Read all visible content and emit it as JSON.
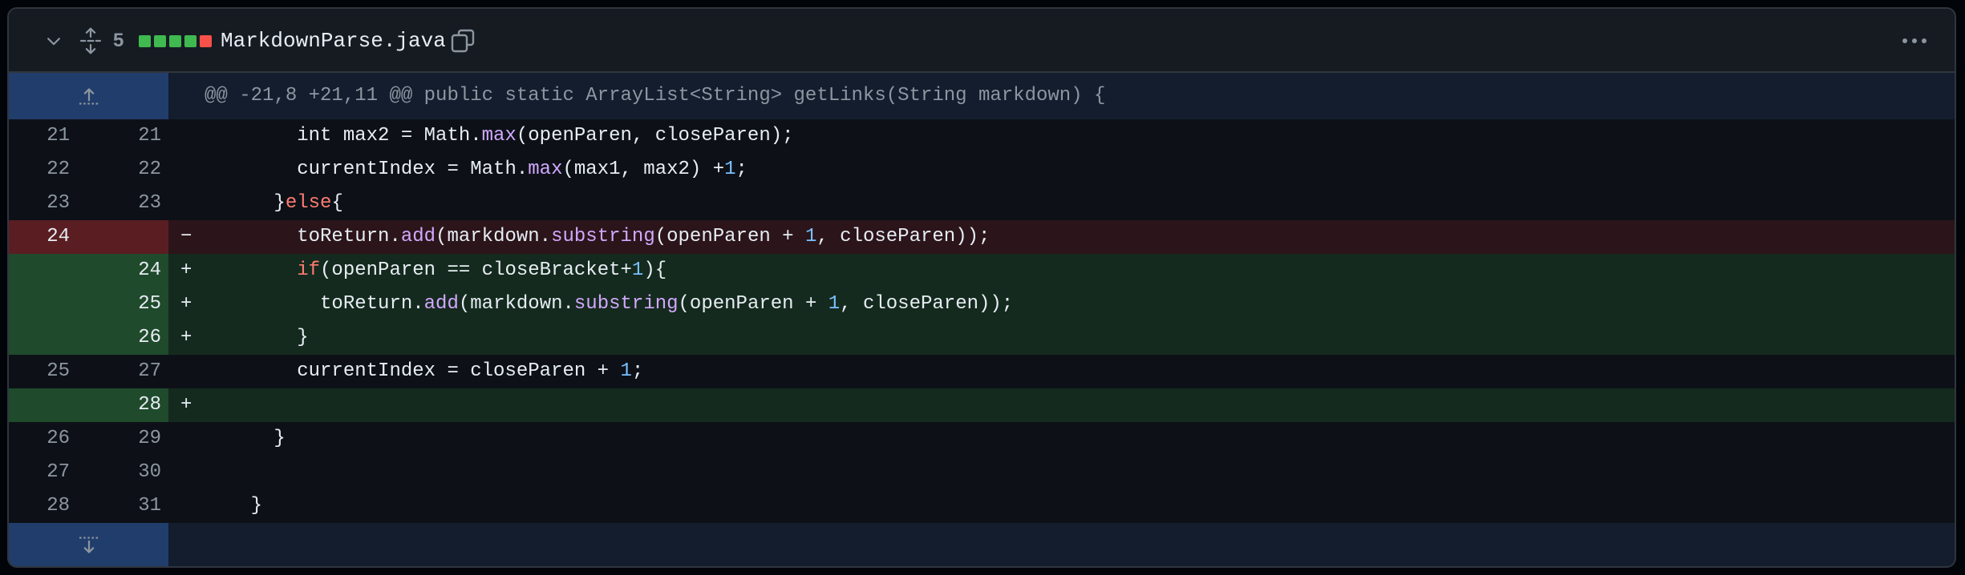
{
  "file": {
    "changes_count": "5",
    "name": "MarkdownParse.java",
    "diffstat_colors": [
      "#3fb950",
      "#3fb950",
      "#3fb950",
      "#3fb950",
      "#f85149"
    ]
  },
  "hunk": {
    "header": "@@ -21,8 +21,11 @@ public static ArrayList<String> getLinks(String markdown) {"
  },
  "lines": [
    {
      "type": "ctx",
      "old": "21",
      "new": "21",
      "marker": "",
      "tokens": [
        [
          "        int max2 = Math.",
          ""
        ],
        [
          "max",
          "call"
        ],
        [
          "(openParen, closeParen);",
          ""
        ]
      ]
    },
    {
      "type": "ctx",
      "old": "22",
      "new": "22",
      "marker": "",
      "tokens": [
        [
          "        currentIndex = Math.",
          ""
        ],
        [
          "max",
          "call"
        ],
        [
          "(max1, max2) +",
          ""
        ],
        [
          "1",
          "num"
        ],
        [
          ";",
          ""
        ]
      ]
    },
    {
      "type": "ctx",
      "old": "23",
      "new": "23",
      "marker": "",
      "tokens": [
        [
          "      }",
          ""
        ],
        [
          "else",
          "kw"
        ],
        [
          "{",
          ""
        ]
      ]
    },
    {
      "type": "del",
      "old": "24",
      "new": "",
      "marker": "−",
      "tokens": [
        [
          "        toReturn.",
          ""
        ],
        [
          "add",
          "call"
        ],
        [
          "(markdown.",
          ""
        ],
        [
          "substring",
          "call"
        ],
        [
          "(openParen + ",
          ""
        ],
        [
          "1",
          "num"
        ],
        [
          ", closeParen));",
          ""
        ]
      ]
    },
    {
      "type": "add",
      "old": "",
      "new": "24",
      "marker": "+",
      "tokens": [
        [
          "        ",
          ""
        ],
        [
          "if",
          "kw"
        ],
        [
          "(openParen == closeBracket+",
          ""
        ],
        [
          "1",
          "num"
        ],
        [
          "){",
          ""
        ]
      ]
    },
    {
      "type": "add",
      "old": "",
      "new": "25",
      "marker": "+",
      "tokens": [
        [
          "          toReturn.",
          ""
        ],
        [
          "add",
          "call"
        ],
        [
          "(markdown.",
          ""
        ],
        [
          "substring",
          "call"
        ],
        [
          "(openParen + ",
          ""
        ],
        [
          "1",
          "num"
        ],
        [
          ", closeParen));",
          ""
        ]
      ]
    },
    {
      "type": "add",
      "old": "",
      "new": "26",
      "marker": "+",
      "tokens": [
        [
          "        }",
          ""
        ]
      ]
    },
    {
      "type": "ctx",
      "old": "25",
      "new": "27",
      "marker": "",
      "tokens": [
        [
          "        currentIndex = closeParen + ",
          ""
        ],
        [
          "1",
          "num"
        ],
        [
          ";",
          ""
        ]
      ]
    },
    {
      "type": "add",
      "old": "",
      "new": "28",
      "marker": "+",
      "tokens": []
    },
    {
      "type": "ctx",
      "old": "26",
      "new": "29",
      "marker": "",
      "tokens": [
        [
          "      }",
          ""
        ]
      ]
    },
    {
      "type": "ctx",
      "old": "27",
      "new": "30",
      "marker": "",
      "tokens": []
    },
    {
      "type": "ctx",
      "old": "28",
      "new": "31",
      "marker": "",
      "tokens": [
        [
          "    }",
          ""
        ]
      ]
    }
  ],
  "icons": {
    "collapse": "chevron-down-icon",
    "expand_all": "unfold-icon",
    "copy": "copy-icon",
    "more": "kebab-horizontal-icon",
    "expand_up": "fold-up-icon",
    "expand_down": "fold-down-icon"
  }
}
